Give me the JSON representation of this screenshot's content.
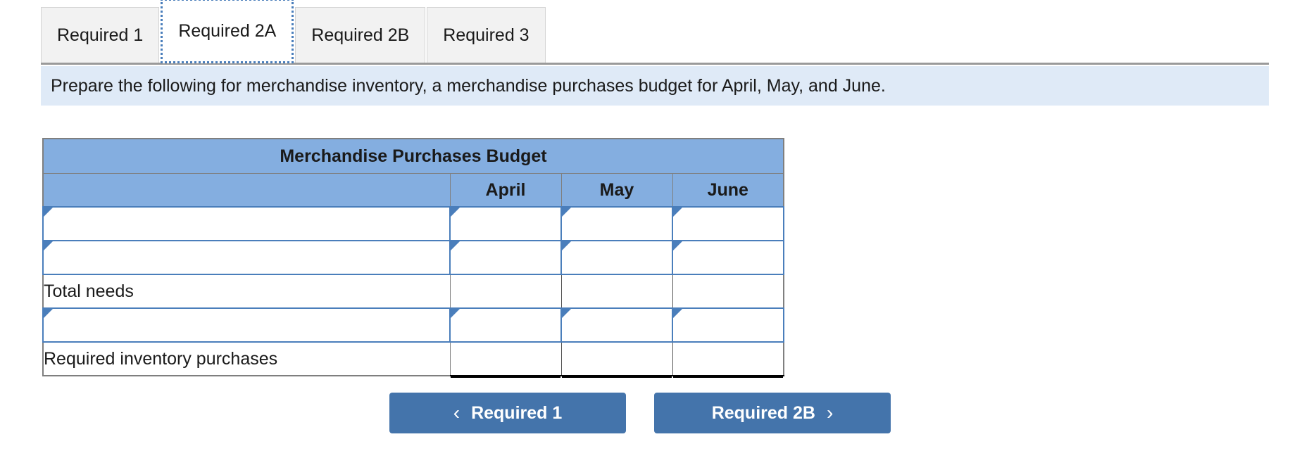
{
  "tabs": [
    {
      "label": "Required 1",
      "active": false
    },
    {
      "label": "Required 2A",
      "active": true
    },
    {
      "label": "Required 2B",
      "active": false
    },
    {
      "label": "Required 3",
      "active": false
    }
  ],
  "instruction": {
    "text": "Prepare the following for merchandise inventory, a merchandise purchases budget for April, May, and June."
  },
  "table": {
    "title": "Merchandise Purchases Budget",
    "row_label_header": "",
    "columns": [
      "April",
      "May",
      "June"
    ],
    "rows": [
      {
        "type": "dropdown",
        "label": "",
        "values": [
          "",
          "",
          ""
        ]
      },
      {
        "type": "dropdown",
        "label": "",
        "values": [
          "",
          "",
          ""
        ]
      },
      {
        "type": "static",
        "label": "Total needs",
        "values": [
          "",
          "",
          ""
        ]
      },
      {
        "type": "dropdown",
        "label": "",
        "values": [
          "",
          "",
          ""
        ]
      },
      {
        "type": "static",
        "label": "Required inventory purchases",
        "values": [
          "",
          "",
          ""
        ]
      }
    ]
  },
  "nav": {
    "prev_label": "Required 1",
    "prev_icon": "chevron-left-icon",
    "prev_glyph": "‹",
    "next_label": "Required 2B",
    "next_icon": "chevron-right-icon",
    "next_glyph": "›"
  },
  "colors": {
    "tab_inactive_bg": "#f2f2f2",
    "tab_active_border": "#4a7ebb",
    "instruction_bg": "#dfeaf7",
    "table_header_bg": "#84aee0",
    "dropdown_border": "#4a7ebb",
    "button_bg": "#4474ab",
    "table_outer_border": "#7f7f7f"
  }
}
